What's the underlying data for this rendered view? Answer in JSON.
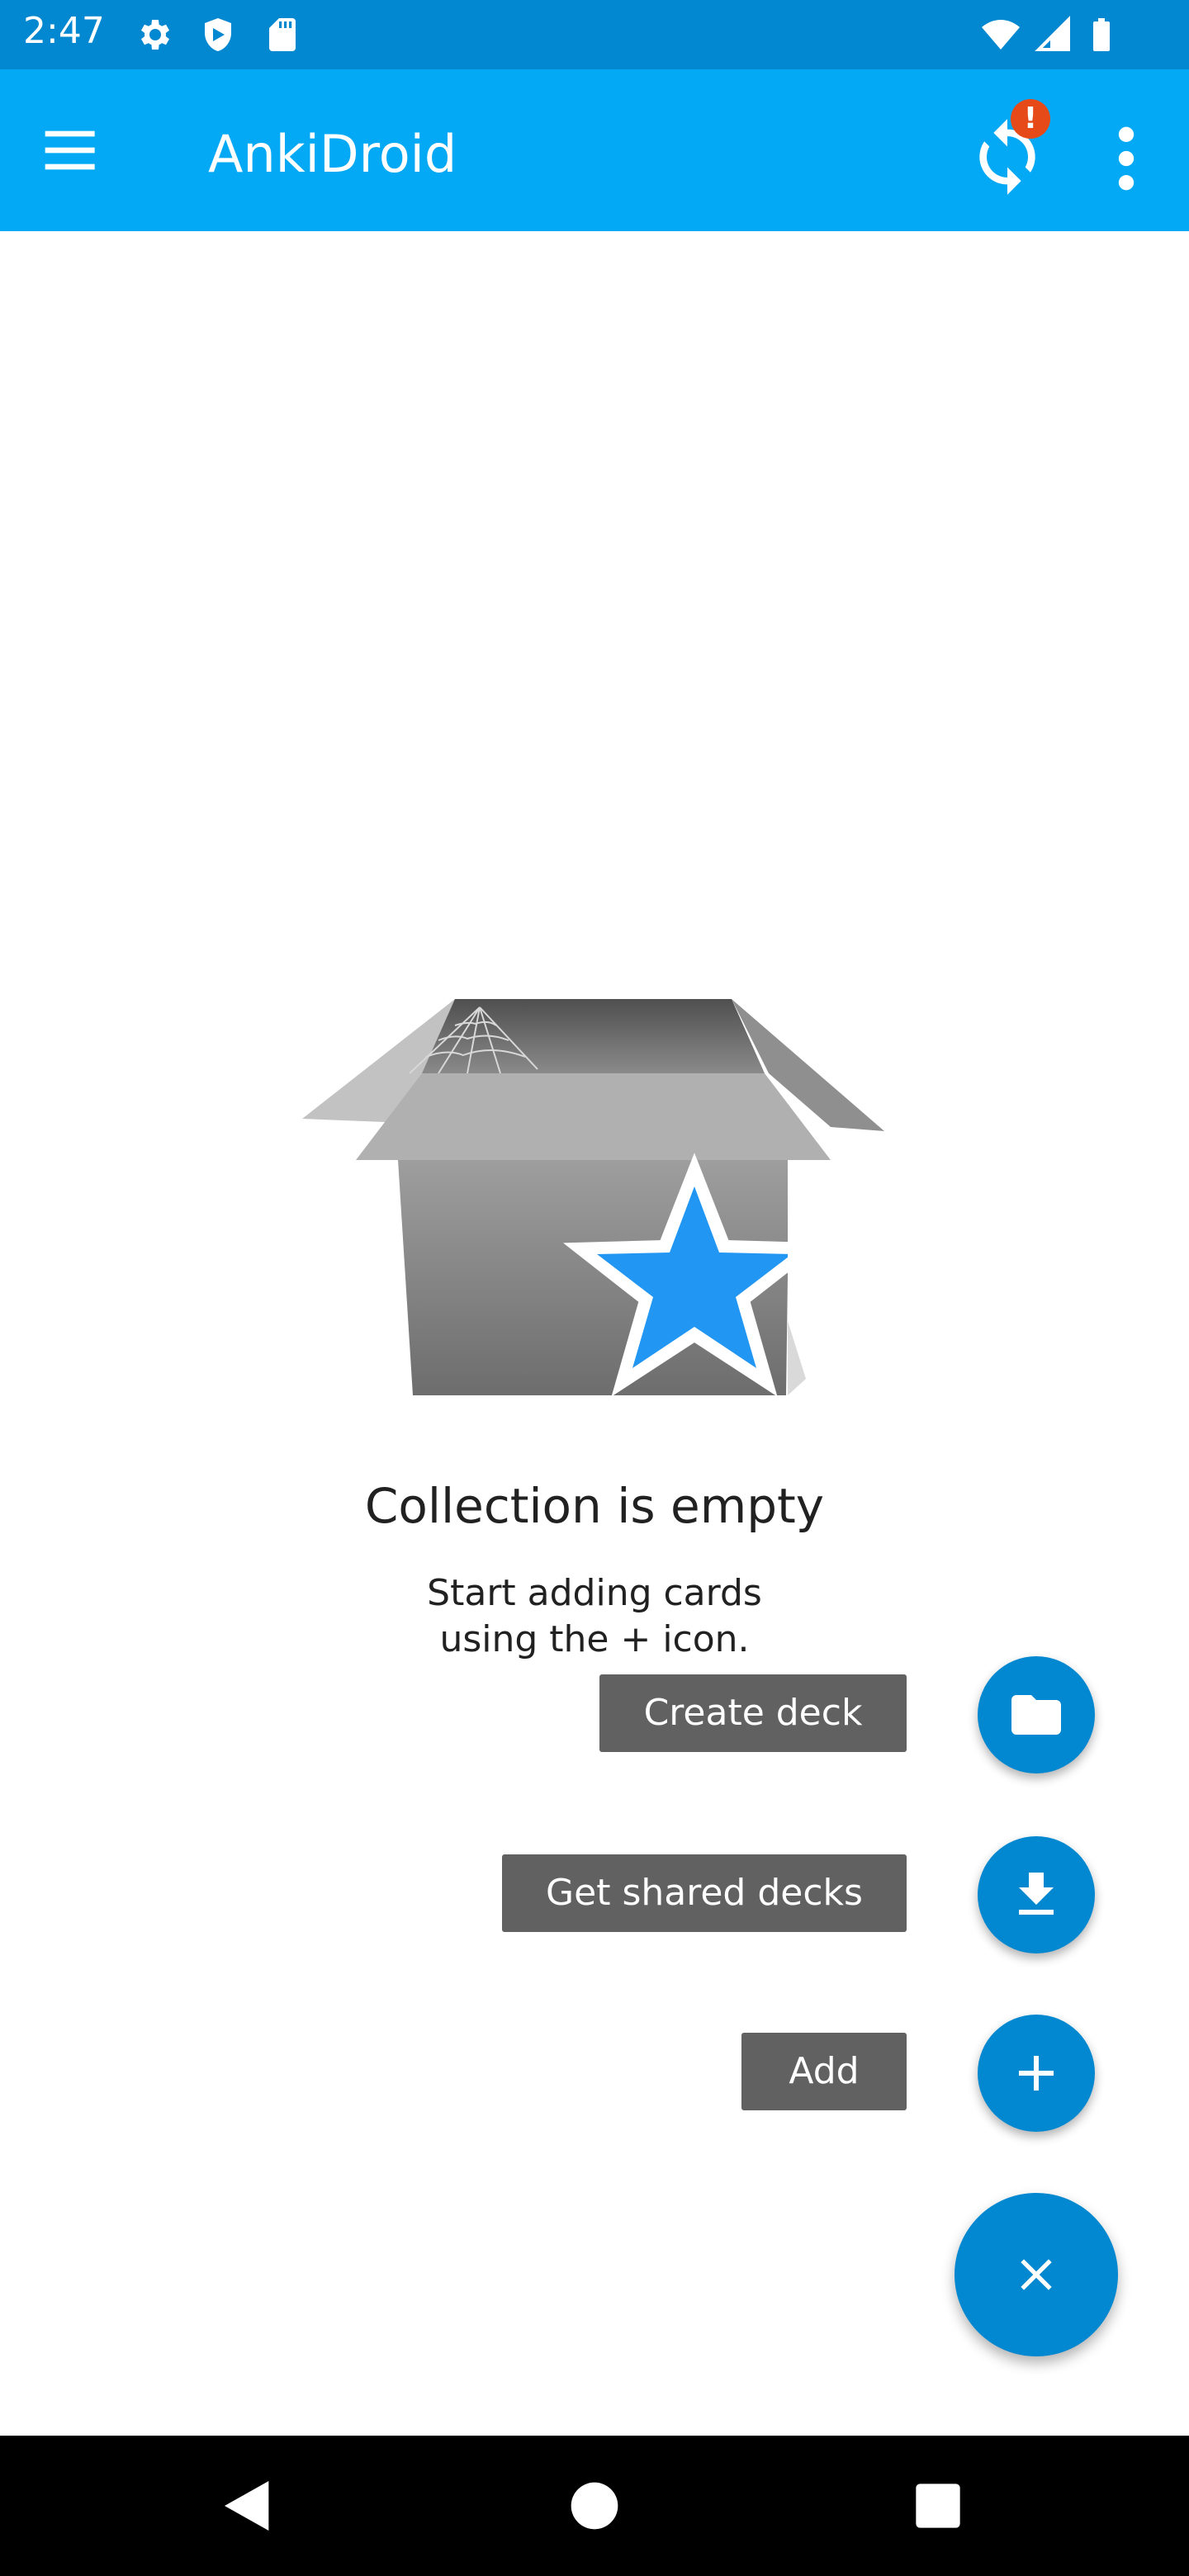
{
  "status_bar": {
    "time": "2:47",
    "icons": [
      "gear-icon",
      "shield-icon",
      "sd-card-icon",
      "wifi-icon",
      "signal-icon",
      "battery-icon"
    ]
  },
  "app_bar": {
    "title": "AnkiDroid",
    "sync_badge": "!",
    "colors": {
      "app_bar": "#03a9f4",
      "status_bar": "#0288d1",
      "badge": "#e64a19"
    }
  },
  "empty_state": {
    "title": "Collection is empty",
    "description": "Start adding cards\nusing the + icon."
  },
  "fab_menu": {
    "items": [
      {
        "label": "Create deck",
        "icon": "folder-icon"
      },
      {
        "label": "Get shared decks",
        "icon": "download-icon"
      },
      {
        "label": "Add",
        "icon": "plus-icon"
      }
    ],
    "main_icon": "close-icon",
    "colors": {
      "fab": "#0288d1",
      "label_bg": "#616161"
    }
  },
  "nav_bar": {
    "icons": [
      "back-icon",
      "home-icon",
      "recents-icon"
    ]
  }
}
